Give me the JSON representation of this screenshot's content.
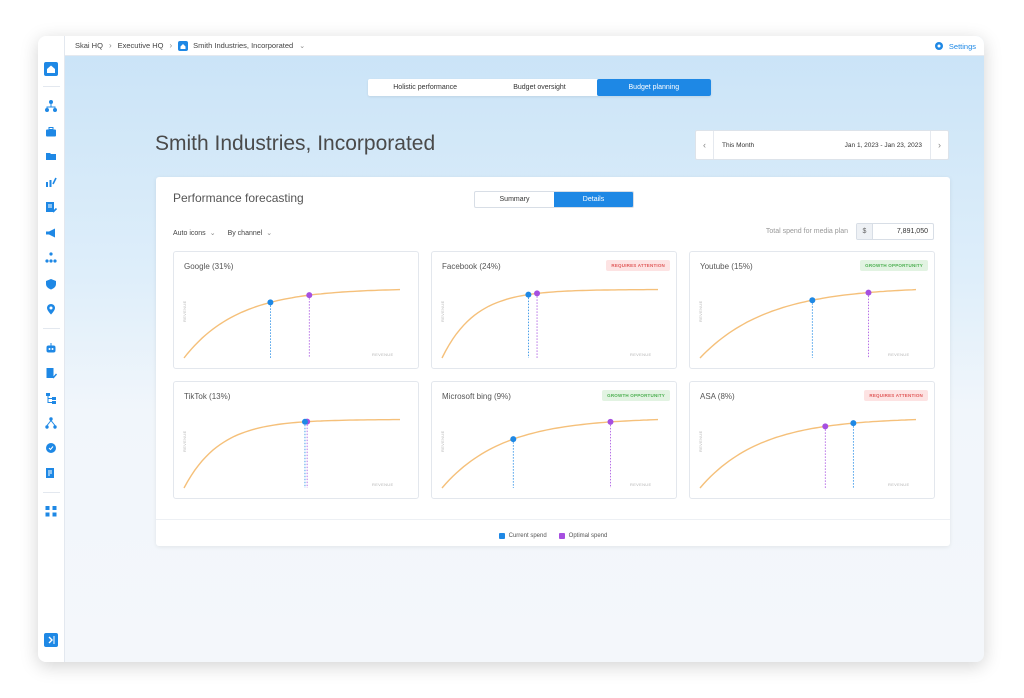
{
  "breadcrumbs": [
    {
      "label": "Skai HQ"
    },
    {
      "label": "Executive HQ"
    },
    {
      "label": "Smith Industries, Incorporated"
    }
  ],
  "settings_label": "Settings",
  "view_tabs": [
    {
      "label": "Holistic performance",
      "active": false
    },
    {
      "label": "Budget oversight",
      "active": false
    },
    {
      "label": "Budget planning",
      "active": true
    }
  ],
  "page_title": "Smith Industries, Incorporated",
  "date_picker": {
    "preset": "This Month",
    "range": "Jan 1, 2023 - Jan 23, 2023"
  },
  "card": {
    "title": "Performance forecasting",
    "segments": [
      {
        "label": "Summary",
        "active": false
      },
      {
        "label": "Details",
        "active": true
      }
    ],
    "filters": [
      {
        "label": "Auto icons"
      },
      {
        "label": "By channel"
      }
    ],
    "spend_label": "Total spend for media plan",
    "currency": "$",
    "spend_value": "7,891,050"
  },
  "axis": {
    "y": "REVENUE",
    "x": "REVENUE"
  },
  "legend": {
    "current": "Current spend",
    "optimal": "Optimal spend"
  },
  "colors": {
    "accent": "#1e88e5",
    "curve": "#f5c07a",
    "current": "#1e88e5",
    "optimal": "#a64fe0"
  },
  "channels": [
    {
      "name": "Google (31%)",
      "badge": "",
      "badge_type": "",
      "current": 0.4,
      "optimal": 0.58,
      "k": 4.0
    },
    {
      "name": "Facebook (24%)",
      "badge": "REQUIRES ATTENTION",
      "badge_type": "red",
      "current": 0.4,
      "optimal": 0.44,
      "k": 6.5
    },
    {
      "name": "Youtube (15%)",
      "badge": "GROWTH OPPORTUNITY",
      "badge_type": "green",
      "current": 0.52,
      "optimal": 0.78,
      "k": 3.2
    },
    {
      "name": "TikTok (13%)",
      "badge": "",
      "badge_type": "",
      "current": 0.56,
      "optimal": 0.57,
      "k": 6.0
    },
    {
      "name": "Microsoft bing (9%)",
      "badge": "GROWTH OPPORTUNITY",
      "badge_type": "green",
      "current": 0.33,
      "optimal": 0.78,
      "k": 3.6
    },
    {
      "name": "ASA (8%)",
      "badge": "REQUIRES ATTENTION",
      "badge_type": "red",
      "current": 0.71,
      "optimal": 0.58,
      "k": 3.6
    }
  ]
}
